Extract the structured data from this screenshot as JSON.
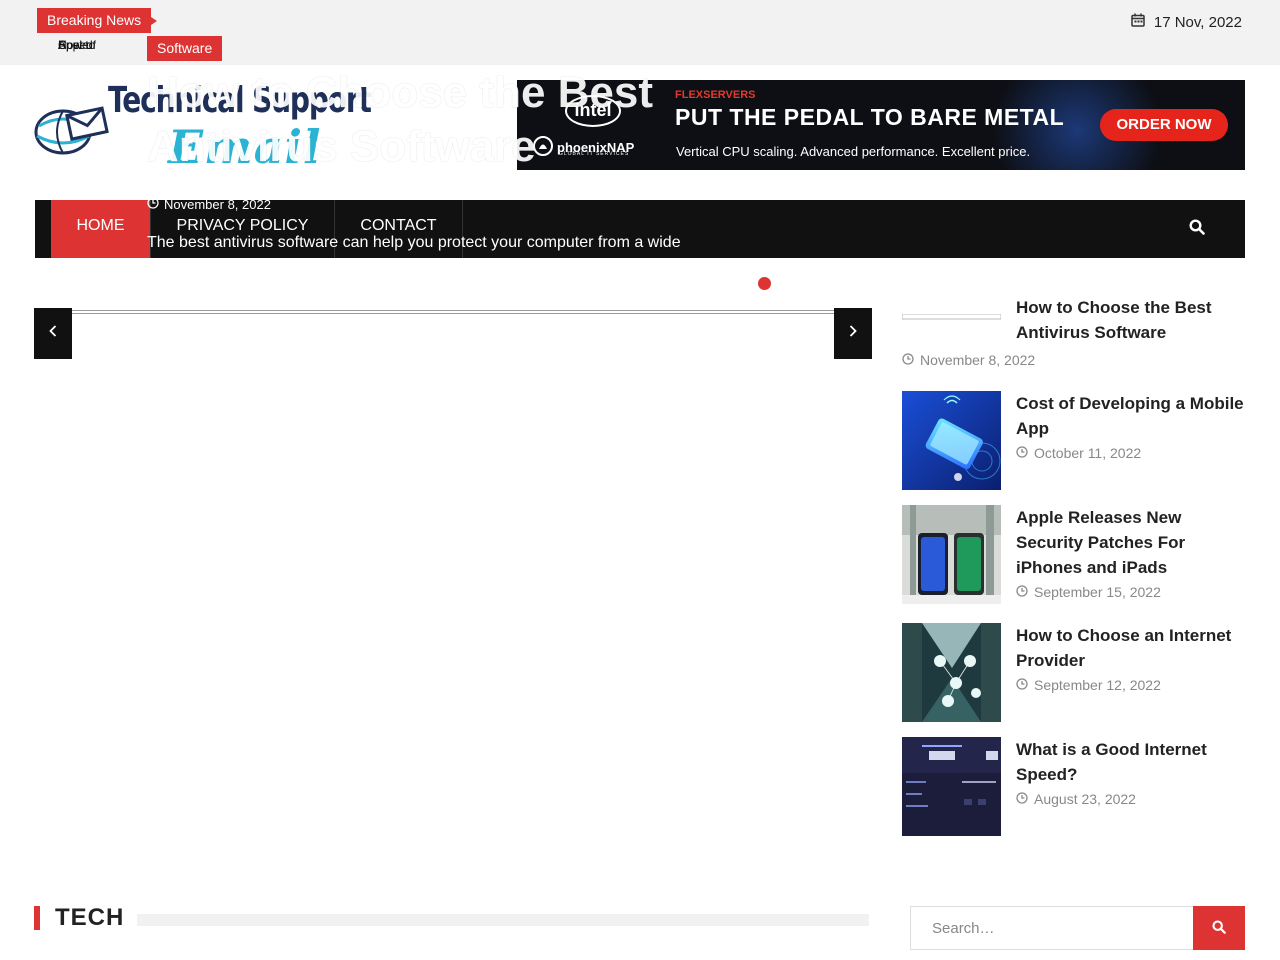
{
  "topbar": {
    "breaking_label": "Breaking News",
    "ticker_items": [
      "Apple",
      "How to",
      "Cost of",
      "Speed"
    ],
    "date": "17 Nov, 2022"
  },
  "logo": {
    "title": "Technical Support",
    "subtitle": "Email"
  },
  "ad": {
    "brand_top": "FLEXSERVERS",
    "intel": "intel",
    "phoenix": "phoenixNAP",
    "phoenix_sub": "GLOBAL IT SERVICES",
    "headline": "PUT THE PEDAL TO BARE METAL",
    "subline": "Vertical CPU scaling. Advanced performance. Excellent price.",
    "cta": "ORDER NOW"
  },
  "nav": {
    "items": [
      "HOME",
      "PRIVACY POLICY",
      "CONTACT"
    ]
  },
  "slider": {
    "category": "Software",
    "title": "How to Choose the Best Antivirus Software",
    "date": "November 8, 2022",
    "excerpt": "The best antivirus software can help you protect your computer from a wide",
    "dots": 4,
    "active_dot": 1
  },
  "sidebar": {
    "posts": [
      {
        "title": "How to Choose the Best Antivirus Software",
        "date": "November 8, 2022"
      },
      {
        "title": "Cost of Developing a Mobile App",
        "date": "October 11, 2022"
      },
      {
        "title": "Apple Releases New Security Patches For iPhones and iPads",
        "date": "September 15, 2022"
      },
      {
        "title": "How to Choose an Internet Provider",
        "date": "September 12, 2022"
      },
      {
        "title": "What is a Good Internet Speed?",
        "date": "August 23, 2022"
      }
    ]
  },
  "section": {
    "title": "TECH"
  },
  "search": {
    "placeholder": "Search…"
  },
  "colors": {
    "accent": "#dd3333",
    "nav_bg": "#111111",
    "logo_blue": "#1e2f58",
    "logo_cyan": "#2bb3d4"
  }
}
